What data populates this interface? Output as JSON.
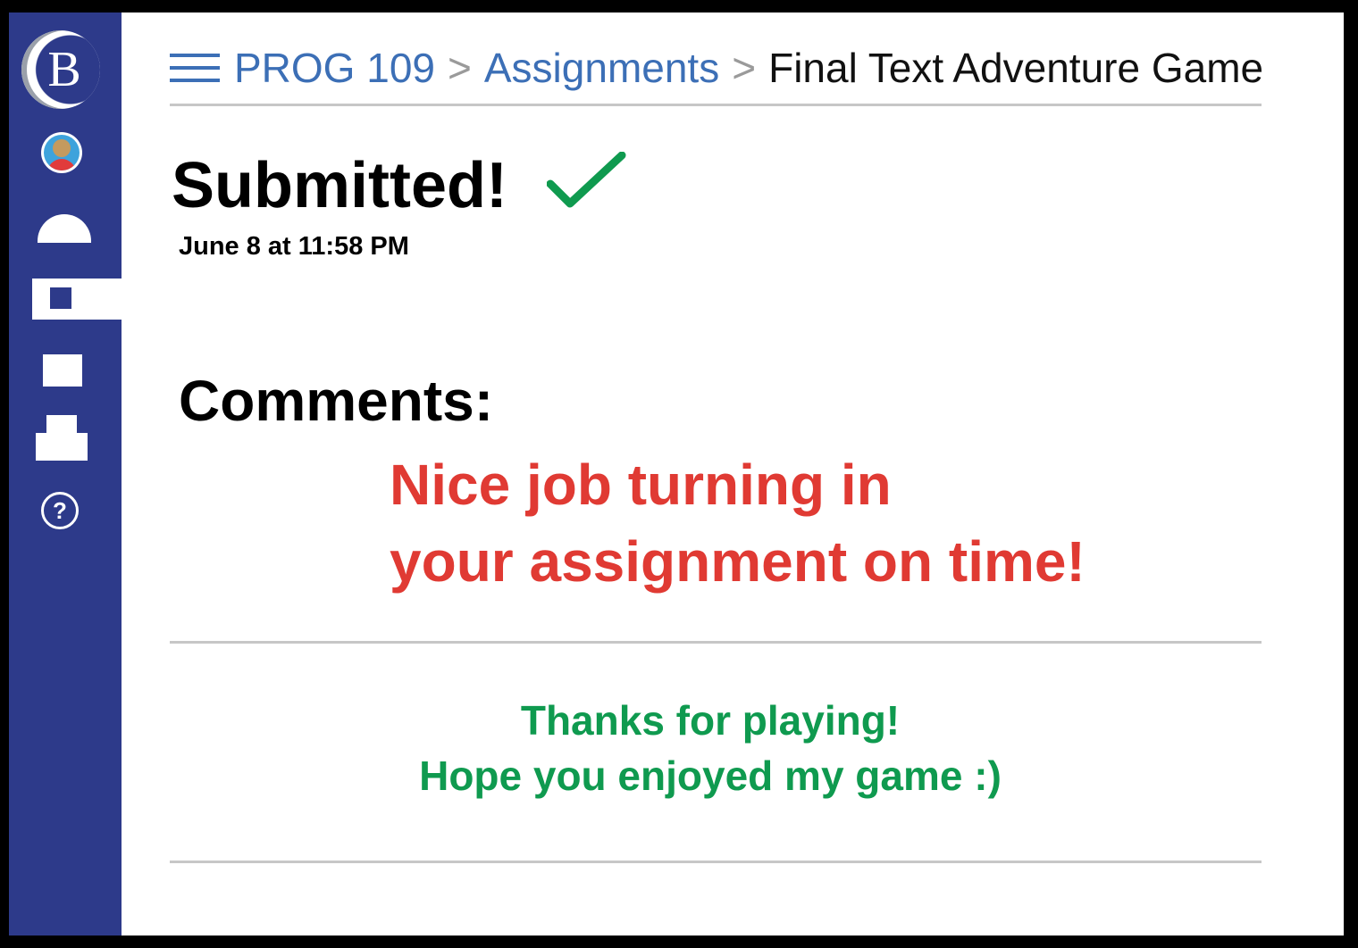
{
  "sidebar": {
    "logo_letter": "B",
    "items": [
      {
        "icon": "avatar-icon"
      },
      {
        "icon": "dome-icon"
      },
      {
        "icon": "active-square-icon"
      },
      {
        "icon": "square-icon"
      },
      {
        "icon": "inbox-icon"
      },
      {
        "icon": "help-icon",
        "label": "?"
      }
    ],
    "color": "#2d3a8a"
  },
  "breadcrumb": {
    "course": "PROG 109",
    "section": "Assignments",
    "current": "Final Text Adventure Game",
    "separator": ">"
  },
  "submission": {
    "status": "Submitted!",
    "timestamp": "June 8 at 11:58 PM",
    "status_color": "#0f9a4f"
  },
  "comments": {
    "label": "Comments:",
    "line1": "Nice job turning in",
    "line2": "your assignment on time!",
    "color": "#e03a33"
  },
  "footer": {
    "line1": "Thanks for playing!",
    "line2": "Hope you enjoyed my game :)",
    "color": "#0f9a4f"
  }
}
